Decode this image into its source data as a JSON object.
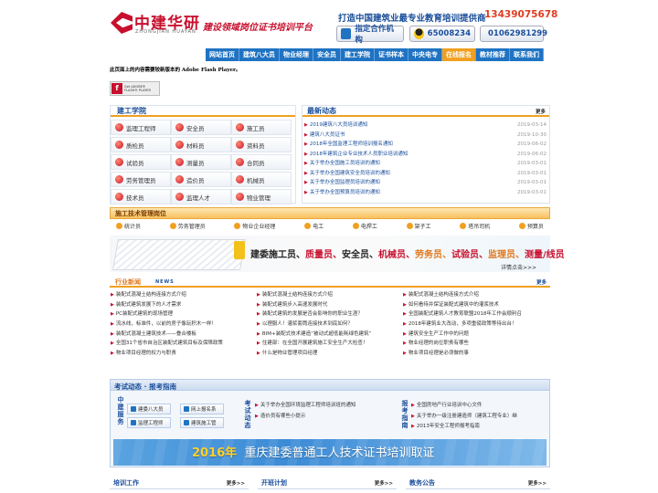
{
  "header": {
    "logo_cn": "中建华研",
    "logo_en": "ZHONGJIAN HUAYAN",
    "slogan": "建设领域岗位证书培训平台",
    "tagline": "打造中国建筑业最专业教育培训提供商",
    "tag_phone": "13439075678",
    "btn_partner": "指定合作机构",
    "btn_qq": "65008234",
    "btn_phone": "01062981299"
  },
  "nav": [
    "网站首页",
    "建筑八大员",
    "物业经理",
    "安全员",
    "建工学院",
    "证书样本",
    "中央电专",
    "在线报名",
    "教材推荐",
    "联系我们"
  ],
  "nav_active_index": 7,
  "notice": "此页面上的内容需要较新版本的 Adobe Flash Player。",
  "flash": {
    "line1": "Get ADOBE®",
    "line2": "FLASH® PLAYER"
  },
  "xueyuan": {
    "title": "建工学院",
    "items": [
      "监理工程师",
      "安全员",
      "施工员",
      "质检员",
      "材料员",
      "资料员",
      "试验员",
      "测量员",
      "合同员",
      "劳务管理员",
      "造价员",
      "机械员",
      "技术员",
      "监理人才",
      "物业管理"
    ]
  },
  "news": {
    "title": "最新动态",
    "more": "更多",
    "items": [
      {
        "t": "2019建筑八大员培训通知",
        "d": "2019-03-14"
      },
      {
        "t": "建筑八大员证书",
        "d": "2019-10-30"
      },
      {
        "t": "2018年全国监理工程师培训报名通知",
        "d": "2019-06-02"
      },
      {
        "t": "2018年建筑企业专业技术人员职业培训通知",
        "d": "2019-06-02"
      },
      {
        "t": "关于举办全国施工员培训的通知",
        "d": "2019-03-01"
      },
      {
        "t": "关于举办全国建筑安全员培训的通知",
        "d": "2019-03-01"
      },
      {
        "t": "关于举办全国监理员培训的通知",
        "d": "2019-03-01"
      },
      {
        "t": "关于举办全国预算员培训的通知",
        "d": "2019-03-01"
      }
    ]
  },
  "tech": {
    "title": "施工技术管理岗位",
    "items": [
      "统计员",
      "劳务管理员",
      "物业企业经理",
      "电工",
      "电焊工",
      "架子工",
      "塔吊司机",
      "预算员"
    ],
    "banner_text": [
      "建委施工员、",
      "质量员、",
      "安全员、",
      "机械员、",
      "劳务员、",
      "试验员、",
      "监理员、",
      "测量/线员"
    ],
    "banner_colors": [
      "#222",
      "#c8102e",
      "#222",
      "#c8102e",
      "#e07820",
      "#c8102e",
      "#e07820",
      "#c8102e"
    ],
    "banner_more": "详情点击>>>"
  },
  "industry": {
    "title": "行业新闻",
    "sub": "NEWS",
    "more": "更多",
    "col1": [
      "装配式混凝土结构连接方式介绍",
      "装配式建筑发展下的人才需求",
      "PC装配式建筑的现场管理",
      "流水线，标准件，以前的房子像玩积木一样！",
      "装配式混凝土建筑技术——叠合楼板",
      "全国31个省市自治区装配式建筑目标及保障政策",
      "物业项目经理的权力与职责"
    ],
    "col2": [
      "装配式混凝土结构连接方式介绍",
      "装配式建筑步入高速发展时代",
      "装配式建筑的发展是否会影响你的职业生涯？",
      "以理服人！灌浆套筒连接技术到底如何？",
      "BIM+装配式技术建造“被动式超低能耗绿色建筑”",
      "住建部：在全国开展建筑施工安全生产大检查！",
      "什么是物业管理项目经理"
    ],
    "col3": [
      "装配式混凝土结构连接方式介绍",
      "如何看待并保证装配式建筑中的灌浆技术",
      "全国装配式建筑人才教育联盟2018年工作会顺利召",
      "2018年建筑业大改动，多项重磅政策等待出台！",
      "建筑安全生产工作中的问题",
      "物业经理的岗位职责有哪些",
      "物业项目经理是必须做的事"
    ]
  },
  "exam": {
    "title": "考试动态 · 报考指南",
    "side1": "中建服务",
    "side2": "考试动态",
    "side3": "报考指南",
    "buttons": [
      "建委八大员",
      "网上报名系",
      "监理工程师",
      "建筑施工管"
    ],
    "links_mid": [
      "关于举办全国环境监理工程师培训班的通知",
      "造价员有哪些小提示"
    ],
    "links_right": [
      "全国房地产行业培训中心文件",
      "关于举办一级注册建造师（建筑工程专业）继",
      "2013年安全工程师报考指南"
    ],
    "banner_year": "2016年",
    "banner_text": "重庆建委普通工人技术证书培训取证"
  },
  "bottom": [
    {
      "t": "培训工作",
      "m": "更多>>"
    },
    {
      "t": "开班计划",
      "m": "更多>>"
    },
    {
      "t": "教务公告",
      "m": "更多>>"
    }
  ]
}
